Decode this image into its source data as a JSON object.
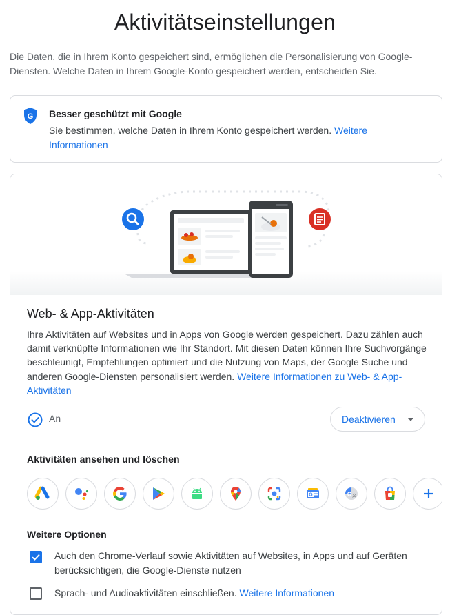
{
  "page": {
    "title": "Aktivitätseinstellungen"
  },
  "intro": "Die Daten, die in Ihrem Konto gespeichert sind, ermöglichen die Personalisierung von Google-Diensten. Welche Daten in Ihrem Google-Konto gespeichert werden, entscheiden Sie.",
  "protected_card": {
    "title": "Besser geschützt mit Google",
    "text": "Sie bestimmen, welche Daten in Ihrem Konto gespeichert werden.",
    "link": "Weitere Informationen",
    "icon": "shield-g-icon"
  },
  "web_app": {
    "title": "Web- & App-Aktivitäten",
    "description": "Ihre Aktivitäten auf Websites und in Apps von Google werden gespeichert. Dazu zählen auch damit verknüpfte Informationen wie Ihr Standort. Mit diesen Daten können Ihre Suchvorgänge beschleunigt, Empfehlungen optimiert und die Nutzung von Maps, der Google Suche und anderen Google-Diensten personalisiert werden.",
    "link": "Weitere Informationen zu Web- & App-Aktivitäten",
    "status": "An",
    "status_icon": "check-circle-icon",
    "deactivate_label": "Deaktivieren"
  },
  "view_delete": {
    "title": "Aktivitäten ansehen und löschen",
    "apps": [
      {
        "name": "google-ads-icon"
      },
      {
        "name": "google-assistant-icon"
      },
      {
        "name": "google-search-icon"
      },
      {
        "name": "google-play-icon"
      },
      {
        "name": "android-icon"
      },
      {
        "name": "google-maps-icon"
      },
      {
        "name": "google-lens-icon"
      },
      {
        "name": "google-news-icon"
      },
      {
        "name": "google-translate-icon"
      },
      {
        "name": "google-shopping-icon"
      },
      {
        "name": "add-icon"
      }
    ]
  },
  "more_options": {
    "title": "Weitere Optionen",
    "option1": "Auch den Chrome-Verlauf sowie Aktivitäten auf Websites, in Apps und auf Geräten berücksichtigen, die Google-Dienste nutzen",
    "option1_checked": true,
    "option2": "Sprach- und Audioaktivitäten einschließen.",
    "option2_link": "Weitere Informationen",
    "option2_checked": false
  },
  "colors": {
    "accent": "#1a73e8",
    "text": "#202124",
    "muted": "#5f6368",
    "border": "#dadce0"
  }
}
